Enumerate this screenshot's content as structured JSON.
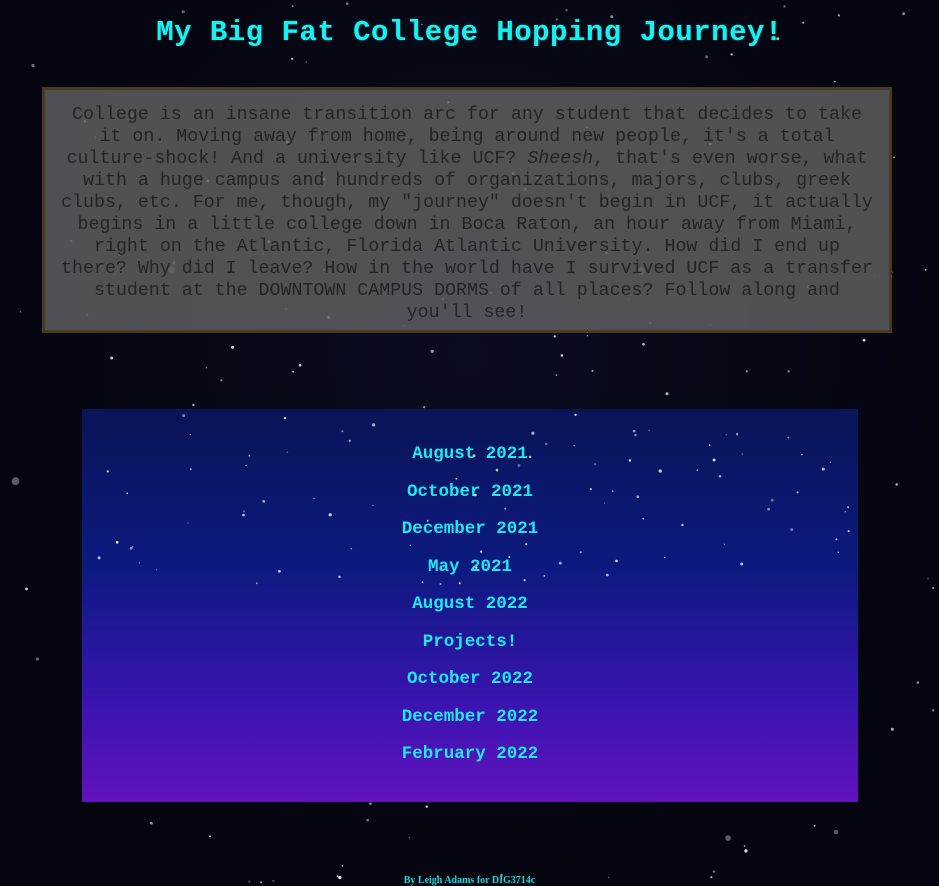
{
  "page": {
    "title": "My Big Fat College Hopping Journey!",
    "intro_before": "College is an insane transition arc for any student that decides to take it on. Moving away from home, being around new people, it's a total culture-shock! And a university like UCF? ",
    "intro_emphasis": "Sheesh",
    "intro_after": ", that's even worse, what with a huge campus and hundreds of organizations, majors, clubs, greek clubs, etc. For me, though, my \"journey\" doesn't begin in UCF, it actually begins in a little college down in Boca Raton, an hour away from Miami, right on the Atlantic, Florida Atlantic University. How did I end up there? Why did I leave? How in the world have I survived UCF as a transfer student at the DOWNTOWN CAMPUS DORMS of all places? Follow along and you'll see!",
    "footer": "By Leigh Adams for DIG3714c"
  },
  "nav": {
    "items": [
      {
        "label": "August 2021"
      },
      {
        "label": "October 2021"
      },
      {
        "label": "December 2021"
      },
      {
        "label": "May 2021"
      },
      {
        "label": "August 2022"
      },
      {
        "label": "Projects!"
      },
      {
        "label": "October 2022"
      },
      {
        "label": "December 2022"
      },
      {
        "label": "February 2022"
      }
    ]
  },
  "colors": {
    "title": "#19f0f0",
    "link": "#1ee9f0",
    "background": "#04050f",
    "intro_box": "#626264",
    "intro_border": "#4a3a22",
    "panel_top": "#0a1456",
    "panel_bottom": "#6212bd"
  }
}
